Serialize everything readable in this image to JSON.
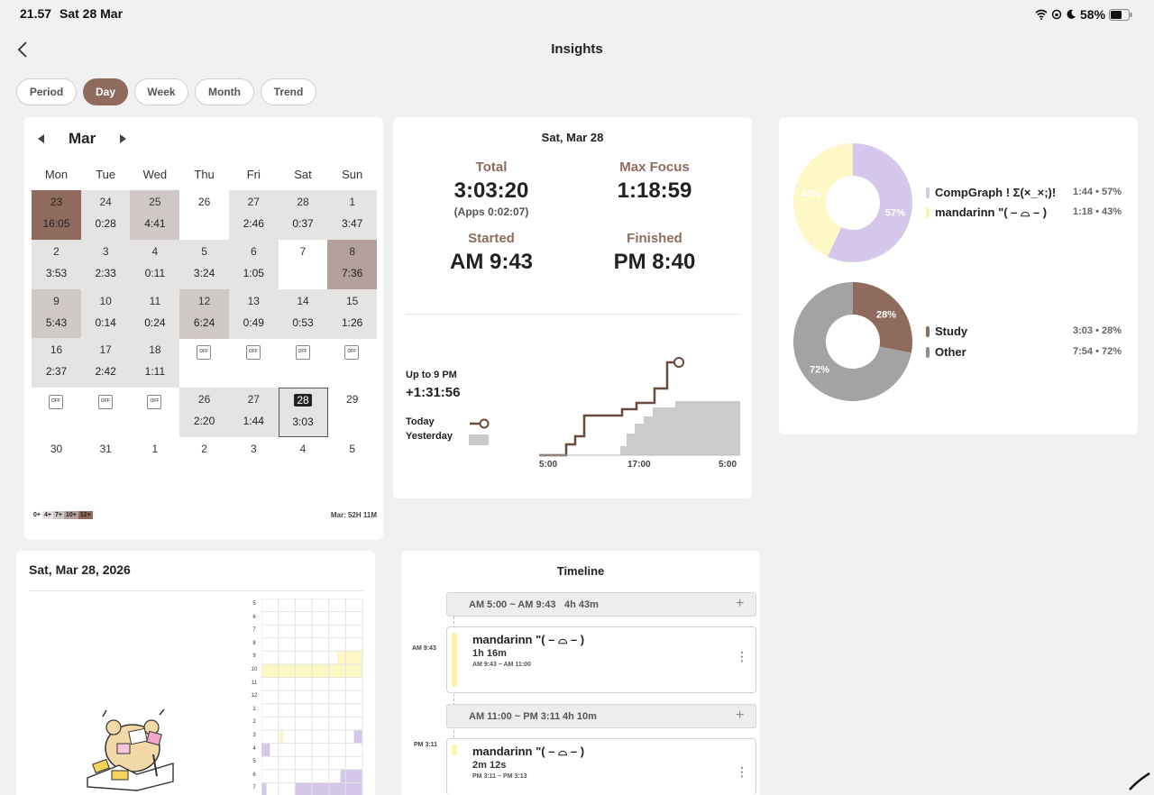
{
  "status_bar": {
    "time": "21.57",
    "date": "Sat 28 Mar",
    "battery": "58%"
  },
  "header": {
    "title": "Insights",
    "back_icon": "chevron-left-icon"
  },
  "tabs": [
    {
      "label": "Period",
      "active": false
    },
    {
      "label": "Day",
      "active": true
    },
    {
      "label": "Week",
      "active": false
    },
    {
      "label": "Month",
      "active": false
    },
    {
      "label": "Trend",
      "active": false
    }
  ],
  "calendar": {
    "month": "Mar",
    "weekdays": [
      "Mon",
      "Tue",
      "Wed",
      "Thu",
      "Fri",
      "Sat",
      "Sun"
    ],
    "rows": [
      [
        {
          "d": "23",
          "t": "16:05",
          "lvl": 4
        },
        {
          "d": "24",
          "t": "0:28",
          "lvl": 1
        },
        {
          "d": "25",
          "t": "4:41",
          "lvl": 2
        },
        {
          "d": "26",
          "t": "",
          "lvl": 0
        },
        {
          "d": "27",
          "t": "2:46",
          "lvl": 1
        },
        {
          "d": "28",
          "t": "0:37",
          "lvl": 1
        },
        {
          "d": "1",
          "t": "3:47",
          "lvl": 1
        }
      ],
      [
        {
          "d": "2",
          "t": "3:53",
          "lvl": 1
        },
        {
          "d": "3",
          "t": "2:33",
          "lvl": 1
        },
        {
          "d": "4",
          "t": "0:11",
          "lvl": 1
        },
        {
          "d": "5",
          "t": "3:24",
          "lvl": 1
        },
        {
          "d": "6",
          "t": "1:05",
          "lvl": 1
        },
        {
          "d": "7",
          "t": "",
          "lvl": 0
        },
        {
          "d": "8",
          "t": "7:36",
          "lvl": 3
        }
      ],
      [
        {
          "d": "9",
          "t": "5:43",
          "lvl": 2
        },
        {
          "d": "10",
          "t": "0:14",
          "lvl": 1
        },
        {
          "d": "11",
          "t": "0:24",
          "lvl": 1
        },
        {
          "d": "12",
          "t": "6:24",
          "lvl": 2
        },
        {
          "d": "13",
          "t": "0:49",
          "lvl": 1
        },
        {
          "d": "14",
          "t": "0:53",
          "lvl": 1
        },
        {
          "d": "15",
          "t": "1:26",
          "lvl": 1
        }
      ],
      [
        {
          "d": "16",
          "t": "2:37",
          "lvl": 1
        },
        {
          "d": "17",
          "t": "2:42",
          "lvl": 1
        },
        {
          "d": "18",
          "t": "1:11",
          "lvl": 1
        },
        {
          "d": "",
          "t": "",
          "lvl": 0,
          "off": true
        },
        {
          "d": "",
          "t": "",
          "lvl": 0,
          "off": true
        },
        {
          "d": "",
          "t": "",
          "lvl": 0,
          "off": true
        },
        {
          "d": "",
          "t": "",
          "lvl": 0,
          "off": true
        }
      ],
      [
        {
          "d": "",
          "t": "",
          "lvl": 0,
          "off": true
        },
        {
          "d": "",
          "t": "",
          "lvl": 0,
          "off": true
        },
        {
          "d": "",
          "t": "",
          "lvl": 0,
          "off": true
        },
        {
          "d": "26",
          "t": "2:20",
          "lvl": 1
        },
        {
          "d": "27",
          "t": "1:44",
          "lvl": 1
        },
        {
          "d": "28",
          "t": "3:03",
          "lvl": 1,
          "sel": true
        },
        {
          "d": "29",
          "t": "",
          "lvl": 0
        }
      ],
      [
        {
          "d": "30",
          "t": "",
          "lvl": 0
        },
        {
          "d": "31",
          "t": "",
          "lvl": 0
        },
        {
          "d": "1",
          "t": "",
          "lvl": 0
        },
        {
          "d": "2",
          "t": "",
          "lvl": 0
        },
        {
          "d": "3",
          "t": "",
          "lvl": 0
        },
        {
          "d": "4",
          "t": "",
          "lvl": 0
        },
        {
          "d": "5",
          "t": "",
          "lvl": 0
        }
      ]
    ],
    "off_label": "OFF",
    "legend": [
      "0+",
      "4+",
      "7+",
      "10+",
      "12+"
    ],
    "total": "Mar: 52H 11M"
  },
  "day_stats": {
    "date": "Sat, Mar 28",
    "total_label": "Total",
    "total_value": "3:03:20",
    "apps_note": "(Apps 0:02:07)",
    "max_label": "Max Focus",
    "max_value": "1:18:59",
    "started_label": "Started",
    "started_value": "AM 9:43",
    "finished_label": "Finished",
    "finished_value": "PM 8:40",
    "up_to_label": "Up to 9 PM",
    "up_to_value": "+1:31:56",
    "today_label": "Today",
    "yesterday_label": "Yesterday",
    "x_ticks": [
      "5:00",
      "17:00",
      "5:00"
    ]
  },
  "donuts": [
    {
      "slices": [
        {
          "name": "CompGraph ! Σ(×_×;)!",
          "pct": 57,
          "pct_label": "57%",
          "value": "1:44 • 57%",
          "color": "#d4c7ea"
        },
        {
          "name": "mandarinn \"( – ⌓ – )",
          "pct": 43,
          "pct_label": "43%",
          "value": "1:18 • 43%",
          "color": "#fdf8c6"
        }
      ]
    },
    {
      "slices": [
        {
          "name": "Study",
          "pct": 28,
          "pct_label": "28%",
          "value": "3:03 • 28%",
          "color": "#8f6b5e"
        },
        {
          "name": "Other",
          "pct": 72,
          "pct_label": "72%",
          "value": "7:54 • 72%",
          "color": "#a3a3a3"
        }
      ]
    }
  ],
  "grid_panel": {
    "date": "Sat, Mar 28, 2026",
    "hours": [
      "5",
      "6",
      "7",
      "8",
      "9",
      "10",
      "11",
      "12",
      "1",
      "2",
      "3",
      "4",
      "5",
      "6",
      "7"
    ]
  },
  "timeline": {
    "title": "Timeline",
    "entries": [
      {
        "type": "gap",
        "label": "AM 5:00 ~ AM 9:43",
        "dur": "4h 43m"
      },
      {
        "type": "session",
        "side": "AM 9:43",
        "name": "mandarinn \"( – ⌓ – )",
        "dur": "1h 16m",
        "range": "AM 9:43 ~ AM 11:00",
        "color": "#fdf3a8"
      },
      {
        "type": "gap",
        "label": "AM 11:00 ~ PM 3:11",
        "dur": "4h 10m"
      },
      {
        "type": "session",
        "side": "PM 3:11",
        "name": "mandarinn \"( – ⌓ – )",
        "dur": "2m 12s",
        "range": "PM 3:11 ~ PM 3:13",
        "color": "#fdf3a8"
      }
    ]
  }
}
